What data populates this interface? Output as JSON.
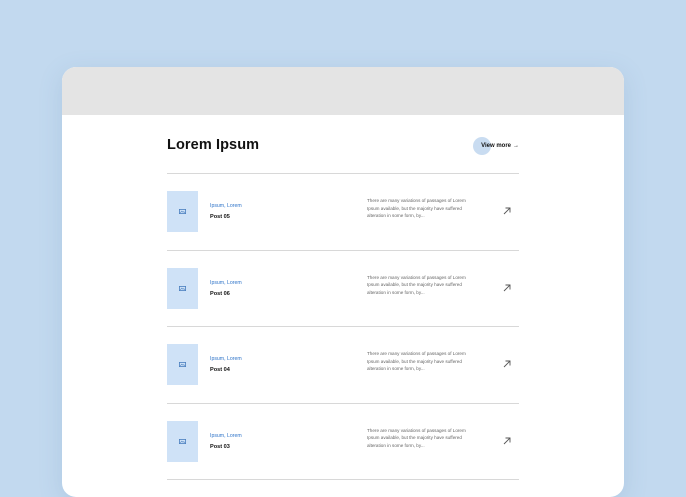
{
  "section": {
    "title": "Lorem Ipsum",
    "view_more": {
      "label": "View more",
      "arrow": "→"
    }
  },
  "posts": [
    {
      "category": "Ipsum, Lorem",
      "title": "Post 05",
      "description": "There are many variations of passages of Lorem Ipsum available, but the majority have suffered alteration in some form, by...",
      "thumbnail_icon": "image-icon",
      "action_icon": "arrow-up-right-icon"
    },
    {
      "category": "Ipsum, Lorem",
      "title": "Post 06",
      "description": "There are many variations of passages of Lorem Ipsum available, but the majority have suffered alteration in some form, by...",
      "thumbnail_icon": "image-icon",
      "action_icon": "arrow-up-right-icon"
    },
    {
      "category": "Ipsum, Lorem",
      "title": "Post 04",
      "description": "There are many variations of passages of Lorem Ipsum available, but the majority have suffered alteration in some form, by...",
      "thumbnail_icon": "image-icon",
      "action_icon": "arrow-up-right-icon"
    },
    {
      "category": "Ipsum, Lorem",
      "title": "Post 03",
      "description": "There are many variations of passages of Lorem Ipsum available, but the majority have suffered alteration in some form, by...",
      "thumbnail_icon": "image-icon",
      "action_icon": "arrow-up-right-icon"
    }
  ],
  "colors": {
    "background": "#c2d9ef",
    "window_bar": "#e4e4e4",
    "accent": "#2f74c9",
    "thumbnail": "#cfe2f7"
  }
}
